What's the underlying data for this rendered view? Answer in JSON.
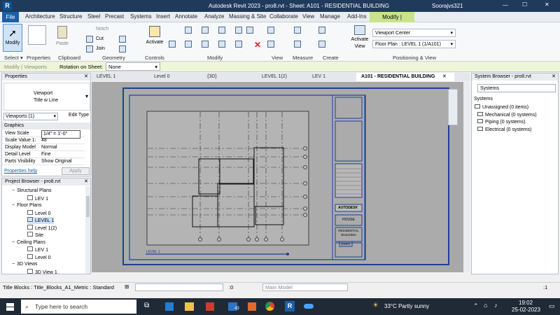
{
  "window": {
    "title": "Autodesk Revit 2023 - pro8.rvt - Sheet: A101 - RESIDENTIAL BUILDING",
    "user": "Soorajvs321"
  },
  "ribbon_tabs": [
    "File",
    "Architecture",
    "Structure",
    "Steel",
    "Precast",
    "Systems",
    "Insert",
    "Annotate",
    "Analyze",
    "Massing & Site",
    "Collaborate",
    "View",
    "Manage",
    "Add-Ins",
    "Modify | Viewports"
  ],
  "ribbon": {
    "modify": "Modify",
    "paste": "Paste",
    "notch": "Notch",
    "cut": "Cut",
    "join": "Join",
    "activate": "Activate",
    "activate_view": "Activate View",
    "viewport_type": "Viewport Center",
    "floor_plan": "Floor Plan : LEVEL 1 (1/A101)",
    "panels": [
      "Select ▾",
      "Properties",
      "Clipboard",
      "Geometry",
      "Controls",
      "Modify",
      "View",
      "Measure",
      "Create",
      "Positioning & View"
    ]
  },
  "options_bar": {
    "context": "Modify | Viewports",
    "rotation_label": "Rotation on Sheet:",
    "rotation_value": "None"
  },
  "view_tabs": [
    "LEVEL 1",
    "Level 0",
    "{3D}",
    "LEVEL 1(2)",
    "LEV 1",
    "A101 - RESIDENTIAL BUILDING"
  ],
  "properties": {
    "title": "Properties",
    "type_name": "Viewport",
    "type_sub": "Title w Line",
    "selector": "Viewports (1)",
    "edit_type": "Edit Type",
    "group": "Graphics",
    "rows": [
      {
        "k": "View Scale",
        "v": "1/4\" = 1'-0\""
      },
      {
        "k": "Scale Value    1:",
        "v": "48"
      },
      {
        "k": "Display Model",
        "v": "Normal"
      },
      {
        "k": "Detail Level",
        "v": "Fine"
      },
      {
        "k": "Parts Visibility",
        "v": "Show Original"
      }
    ],
    "help": "Properties help",
    "apply": "Apply"
  },
  "project_browser": {
    "title": "Project Browser - pro8.rvt",
    "items": [
      {
        "t": "Structural Plans",
        "lv": 1
      },
      {
        "t": "LEV 1",
        "lv": 2
      },
      {
        "t": "Floor Plans",
        "lv": 1
      },
      {
        "t": "Level 0",
        "lv": 2
      },
      {
        "t": "LEVEL 1",
        "lv": 2
      },
      {
        "t": "Level 1(2)",
        "lv": 2
      },
      {
        "t": "Site",
        "lv": 2
      },
      {
        "t": "Ceiling Plans",
        "lv": 1
      },
      {
        "t": "LEV 1",
        "lv": 2
      },
      {
        "t": "Level 0",
        "lv": 2
      },
      {
        "t": "3D Views",
        "lv": 1
      },
      {
        "t": "3D View 1",
        "lv": 2
      }
    ]
  },
  "system_browser": {
    "title": "System Browser - pro8.rvt",
    "filter": "Systems",
    "root": "Systems",
    "items": [
      "Unassigned (0 items)",
      "Mechanical (0 systems)",
      "Piping (0 systems)",
      "Electrical (0 systems)"
    ]
  },
  "sheet": {
    "company": "AUTODESK",
    "project": "HOUSE",
    "sheet_name": "RESIDENTIAL BUILDING",
    "owner": "Owner",
    "view_title": "LEVEL 1"
  },
  "status": {
    "text": "Title Blocks : Title_Blocks_A1_Metric : Standard",
    "zero": ":0",
    "model": "Main Model",
    "filter": ":1"
  },
  "taskbar": {
    "search": "Type here to search",
    "weather": "33°C  Partly sunny",
    "time": "19:02",
    "date": "25-02-2023",
    "notif": "43"
  }
}
